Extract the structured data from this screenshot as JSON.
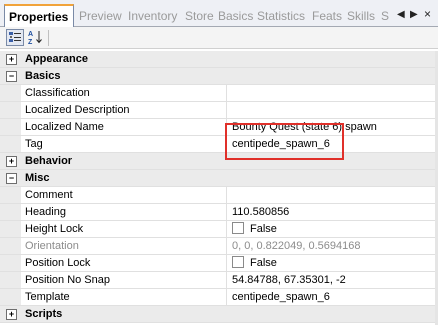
{
  "tabs": [
    {
      "label": "Properties",
      "active": true
    },
    {
      "label": "Preview"
    },
    {
      "label": "Inventory"
    },
    {
      "label": "Store"
    },
    {
      "label": "Basics"
    },
    {
      "label": "Statistics"
    },
    {
      "label": "Feats"
    },
    {
      "label": "Skills"
    },
    {
      "label": "S"
    }
  ],
  "tab_controls": {
    "prev": "◀",
    "next": "▶",
    "close": "×"
  },
  "toolbar": {
    "categorized_icon": "categorized-view-icon",
    "alphabetical_icon": "alphabetical-sort-icon",
    "alphabetical_text": "AZ"
  },
  "grid": {
    "appearance": {
      "label": "Appearance",
      "toggle": "+"
    },
    "basics": {
      "label": "Basics",
      "toggle": "−",
      "classification": {
        "name": "Classification",
        "value": ""
      },
      "localized_description": {
        "name": "Localized Description",
        "value": ""
      },
      "localized_name": {
        "name": "Localized Name",
        "value": "Bounty Quest (state 6) spawn"
      },
      "tag": {
        "name": "Tag",
        "value": "centipede_spawn_6"
      }
    },
    "behavior": {
      "label": "Behavior",
      "toggle": "+"
    },
    "misc": {
      "label": "Misc",
      "toggle": "−",
      "comment": {
        "name": "Comment",
        "value": ""
      },
      "heading": {
        "name": "Heading",
        "value": "110.580856"
      },
      "height_lock": {
        "name": "Height Lock",
        "value": "False"
      },
      "orientation": {
        "name": "Orientation",
        "value": "0, 0, 0.822049, 0.5694168"
      },
      "position_lock": {
        "name": "Position Lock",
        "value": "False"
      },
      "position_no_snap": {
        "name": "Position No Snap",
        "value": "54.84788, 67.35301, -2"
      },
      "template": {
        "name": "Template",
        "value": "centipede_spawn_6"
      }
    },
    "scripts": {
      "label": "Scripts",
      "toggle": "+"
    }
  },
  "colors": {
    "highlight_box": "#e0302a",
    "active_tab_accent": "#f1a33a"
  }
}
